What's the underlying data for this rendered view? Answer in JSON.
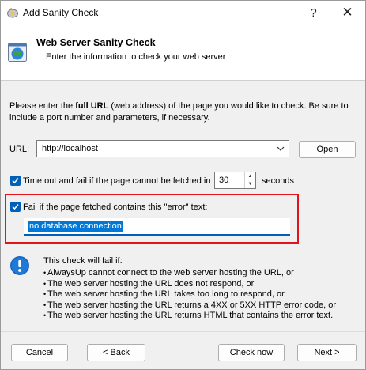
{
  "window": {
    "title": "Add Sanity Check",
    "help_glyph": "?",
    "close_glyph": "✕"
  },
  "header": {
    "title": "Web Server Sanity Check",
    "subtitle": "Enter the information to check your web server"
  },
  "intro": {
    "before_bold": "Please enter the ",
    "bold": "full URL",
    "after_bold": " (web address) of the page you would like to check. Be sure to include a port number and parameters, if necessary."
  },
  "url": {
    "label": "URL:",
    "value": "http://localhost",
    "open_label": "Open"
  },
  "timeout": {
    "checked": true,
    "label": "Time out and fail if the page cannot be fetched in",
    "value": "30",
    "unit": "seconds"
  },
  "error_text": {
    "checked": true,
    "label": "Fail if the page fetched contains this \"error\" text:",
    "value": "no database connection"
  },
  "fail_info": {
    "heading": "This check will fail if:",
    "bullet": "•",
    "items": [
      "AlwaysUp cannot connect to the web server hosting the URL, or",
      "The web server hosting the URL does not respond, or",
      "The web server hosting the URL takes too long to respond, or",
      "The web server hosting the URL returns a 4XX or 5XX HTTP error code, or",
      "The web server hosting the URL returns HTML that contains the error text."
    ]
  },
  "buttons": {
    "cancel": "Cancel",
    "back": "< Back",
    "check_now": "Check now",
    "next": "Next >"
  },
  "colors": {
    "accent": "#005fb8",
    "highlight": "#e2141b",
    "selection": "#0078d7"
  }
}
